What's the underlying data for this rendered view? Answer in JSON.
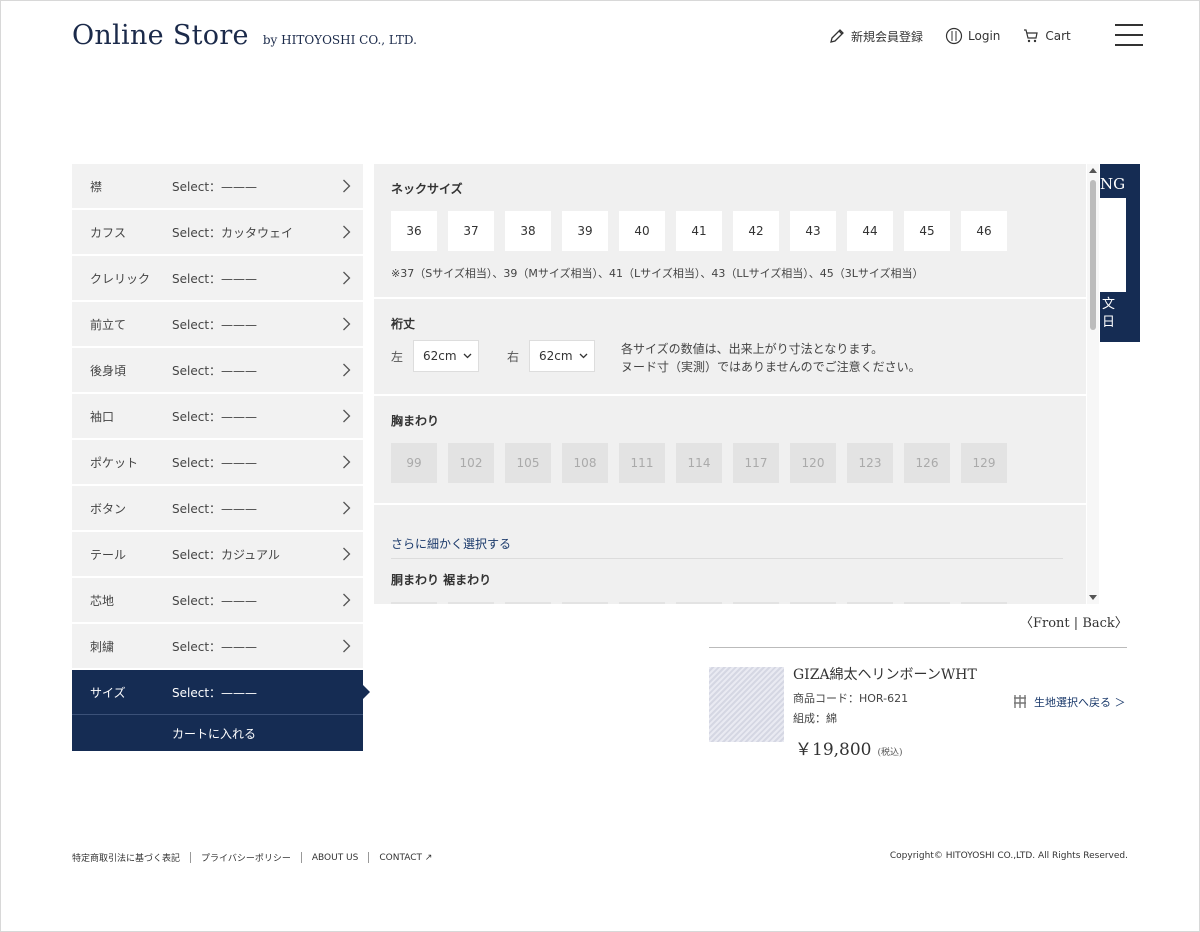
{
  "header": {
    "logo_main": "Online Store",
    "logo_sub": "by HITOYOSHI CO., LTD.",
    "nav": [
      {
        "label": "新規会員登録",
        "icon": "pen-icon"
      },
      {
        "label": "Login",
        "icon": "user-circle-icon"
      },
      {
        "label": "Cart",
        "icon": "cart-icon"
      }
    ]
  },
  "sidebar": {
    "items": [
      {
        "label": "襟",
        "value": "Select：———"
      },
      {
        "label": "カフス",
        "value": "Select：カッタウェイ"
      },
      {
        "label": "クレリック",
        "value": "Select：———"
      },
      {
        "label": "前立て",
        "value": "Select：———"
      },
      {
        "label": "後身頃",
        "value": "Select：———"
      },
      {
        "label": "袖口",
        "value": "Select：———"
      },
      {
        "label": "ポケット",
        "value": "Select：———"
      },
      {
        "label": "ボタン",
        "value": "Select：———"
      },
      {
        "label": "テール",
        "value": "Select：カジュアル"
      },
      {
        "label": "芯地",
        "value": "Select：———"
      },
      {
        "label": "刺繍",
        "value": "Select：———"
      },
      {
        "label": "サイズ",
        "value": "Select：———"
      }
    ],
    "cart_button": "カートに入れる"
  },
  "options": {
    "neck": {
      "title": "ネックサイズ",
      "sizes": [
        "36",
        "37",
        "38",
        "39",
        "40",
        "41",
        "42",
        "43",
        "44",
        "45",
        "46"
      ],
      "note": "※37（Sサイズ相当）、39（Mサイズ相当）、41（Lサイズ相当）、43（LLサイズ相当）、45（3Lサイズ相当）"
    },
    "sleeve": {
      "title": "裄丈",
      "left_label": "左",
      "left_value": "62cm",
      "right_label": "右",
      "right_value": "62cm",
      "note_line1": "各サイズの数値は、出来上がり寸法となります。",
      "note_line2": "ヌード寸（実測）ではありませんのでご注意ください。"
    },
    "chest": {
      "title": "胸まわり",
      "sizes": [
        "99",
        "102",
        "105",
        "108",
        "111",
        "114",
        "117",
        "120",
        "123",
        "126",
        "129"
      ]
    },
    "more_link": "さらに細かく選択する",
    "waist_title": "胴まわり 裾まわり"
  },
  "side_box": {
    "top_text": "NG",
    "bottom_text": "文日"
  },
  "view_toggle": {
    "front": "〈Front",
    "sep": " | ",
    "back": "Back〉"
  },
  "product": {
    "name": "GIZA綿太ヘリンボーンWHT",
    "code": "商品コード：HOR-621",
    "composition": "組成：綿",
    "price": "￥19,800",
    "tax": "(税込)",
    "back_link": "生地選択へ戻る ＞"
  },
  "footer": {
    "links": [
      "特定商取引法に基づく表記",
      "プライバシーポリシー",
      "ABOUT US",
      "CONTACT ↗"
    ],
    "copyright": "Copyright© HITOYOSHI CO.,LTD. All Rights Reserved."
  },
  "colors": {
    "navy": "#152c53",
    "panel_bg": "#f0f0f0",
    "link": "#1b3a6b"
  }
}
